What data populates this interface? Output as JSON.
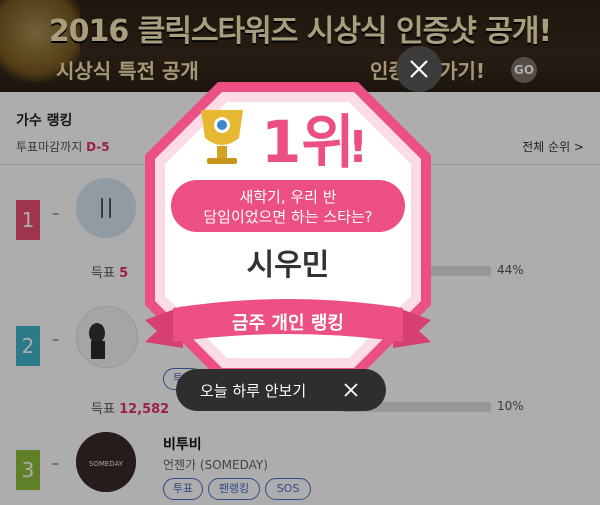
{
  "banner": {
    "title": "2016 클릭스타워즈 시상식 인증샷 공개!",
    "subtitle_left": "시상식 특전 공개",
    "subtitle_right": "인증 러 가기!",
    "go_label": "GO"
  },
  "ranking": {
    "section_title": "가수 랭킹",
    "deadline_label": "투표마감까지",
    "deadline_value": "D-5",
    "all_rank_link": "전체 순위 >",
    "vote_label": "득표",
    "vote_button": "투표",
    "fanrank_button": "팬랭킹",
    "sos_button": "SOS",
    "rows": [
      {
        "rank": "1",
        "trend": "–",
        "votes": "5",
        "percent_text": "44%",
        "percent": 44,
        "name": "",
        "song": ""
      },
      {
        "rank": "2",
        "trend": "–",
        "votes": "12,582",
        "percent_text": "10%",
        "percent": 10,
        "name": "",
        "song": ""
      },
      {
        "rank": "3",
        "trend": "–",
        "votes": "",
        "percent_text": "",
        "percent": null,
        "name": "비투비",
        "song": "언젠가 (SOMEDAY)",
        "thumb_text": "SOMEDAY"
      }
    ],
    "colors": {
      "rank1": "#e94d73",
      "rank2": "#3fb4cc",
      "rank3": "#8cbd3a",
      "accent": "#e4306c",
      "button": "#4a6fc8"
    }
  },
  "popup": {
    "rank_label": "1위",
    "exclaim": "!",
    "question_line1": "새학기, 우리 반",
    "question_line2": "담임이었으면 하는 스타는?",
    "winner": "시우민",
    "ribbon": "금주 개인 랭킹",
    "colors": {
      "pink": "#ec4f82",
      "light_pink": "#fbdbe6",
      "gold": "#e6b832"
    }
  },
  "dialog": {
    "no_show_today": "오늘 하루 안보기"
  }
}
